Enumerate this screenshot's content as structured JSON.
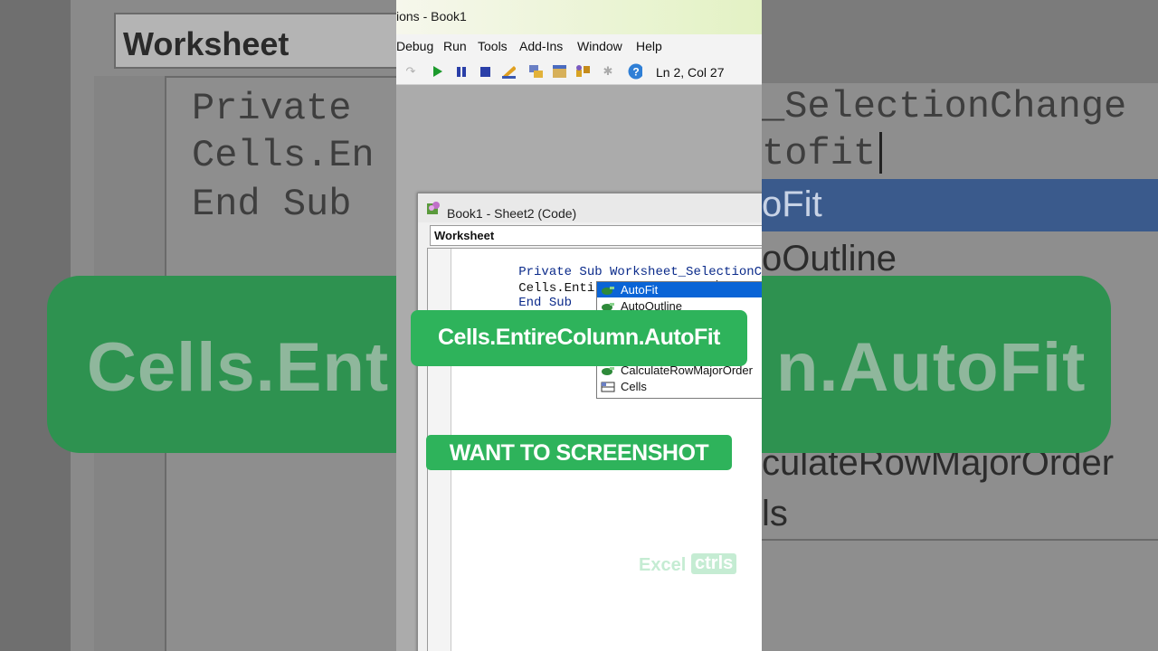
{
  "app": {
    "window_title": "ions - Book1"
  },
  "menu": [
    "Debug",
    "Run",
    "Tools",
    "Add-Ins",
    "Window",
    "Help"
  ],
  "toolbar": {
    "status": "Ln 2, Col 27"
  },
  "code_window": {
    "title": "Book1 - Sheet2 (Code)",
    "object_combo": "Worksheet",
    "lines": [
      "Private Sub Worksheet_SelectionChange",
      "Cells.EntireColumn.Autofit",
      "End Sub"
    ]
  },
  "autocomplete": {
    "items": [
      "AutoFit",
      "AutoOutline",
      "CalculateRowMajorOrder",
      "Cells"
    ],
    "selected": "AutoFit"
  },
  "overlays": {
    "caption_main": "Cells.EntireColumn.AutoFit",
    "caption_sub": "WANT TO SCREENSHOT",
    "watermark_a": "Excel",
    "watermark_b": "ctrls"
  },
  "background": {
    "combo": "Worksheet",
    "left_lines": [
      "Private",
      "Cells.En",
      "End Sub"
    ],
    "right_lines": [
      "_SelectionChange",
      "tofit"
    ],
    "right_items": [
      "oFit",
      "oOutline",
      "culateRowMajorOrder",
      "ls"
    ],
    "band_left": "Cells.Ent",
    "band_right": "n.AutoFit"
  },
  "colors": {
    "accent_green": "#2eb35b",
    "selection_blue": "#0a64d6",
    "keyword_blue": "#0a2a8a"
  }
}
